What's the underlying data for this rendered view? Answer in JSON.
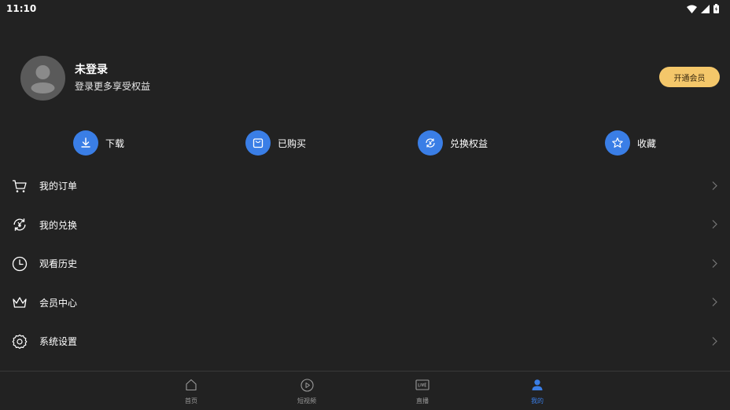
{
  "status": {
    "time": "11:10"
  },
  "profile": {
    "name": "未登录",
    "subtitle": "登录更多享受权益",
    "vip_button": "开通会员"
  },
  "quick_actions": [
    {
      "label": "下载",
      "icon": "download-icon"
    },
    {
      "label": "已购买",
      "icon": "purchased-bag-icon"
    },
    {
      "label": "兑换权益",
      "icon": "exchange-yen-icon"
    },
    {
      "label": "收藏",
      "icon": "star-icon"
    }
  ],
  "menu": [
    {
      "label": "我的订单",
      "icon": "cart-icon"
    },
    {
      "label": "我的兑换",
      "icon": "exchange-yen-icon"
    },
    {
      "label": "观看历史",
      "icon": "clock-icon"
    },
    {
      "label": "会员中心",
      "icon": "crown-icon"
    },
    {
      "label": "系统设置",
      "icon": "gear-icon"
    }
  ],
  "bottom_nav": [
    {
      "label": "首页",
      "icon": "home-icon",
      "active": false
    },
    {
      "label": "短视频",
      "icon": "play-circle-icon",
      "active": false
    },
    {
      "label": "直播",
      "icon": "live-tv-icon",
      "active": false
    },
    {
      "label": "我的",
      "icon": "person-icon",
      "active": true
    }
  ],
  "colors": {
    "background": "#222222",
    "accent": "#3a7ee6",
    "vip": "#f4c76a"
  }
}
